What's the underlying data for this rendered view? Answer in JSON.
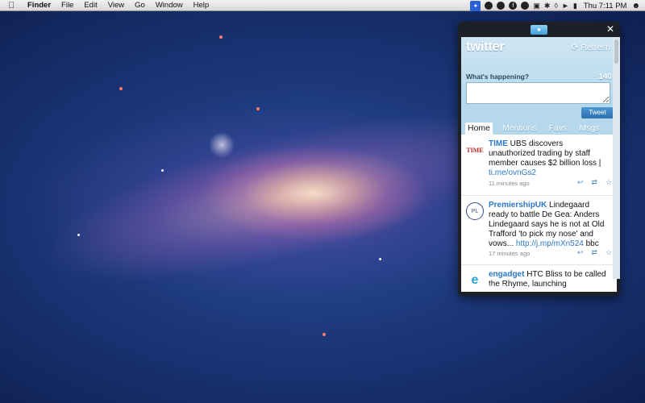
{
  "menubar": {
    "apple_icon": "apple-icon",
    "app_name": "Finder",
    "items": [
      "File",
      "Edit",
      "View",
      "Go",
      "Window",
      "Help"
    ],
    "clock": "Thu 7:11 PM"
  },
  "twitter": {
    "logo": "twitter",
    "refresh_label": "Refresh",
    "prompt": "What's happening?",
    "char_count": "140",
    "tweet_button": "Tweet",
    "tabs": [
      "Home",
      "Mentions",
      "Favs",
      "Msgs"
    ],
    "active_tab": "Home",
    "tweets": [
      {
        "user": "TIME",
        "avatar_text": "TIME",
        "text": " UBS discovers unauthorized trading by staff member causes $2 billion loss | ",
        "link": "ti.me/ovnGs2",
        "suffix": "",
        "time": "11 minutes ago"
      },
      {
        "user": "PremiershipUK",
        "avatar_text": "PL",
        "text": " Lindegaard ready to battle De Gea: Anders Lindegaard says he is not at Old Trafford 'to pick my nose' and vows... ",
        "link": "http://j.mp/mXn524",
        "suffix": " bbc",
        "time": "17 minutes ago"
      },
      {
        "user": "engadget",
        "avatar_text": "e",
        "text": " HTC Bliss to be called the Rhyme, launching",
        "link": "",
        "suffix": "",
        "time": ""
      }
    ],
    "colors": {
      "link": "#2b77c9",
      "header_blue": "#b5d8ec",
      "window_dark": "#1d2127"
    }
  }
}
